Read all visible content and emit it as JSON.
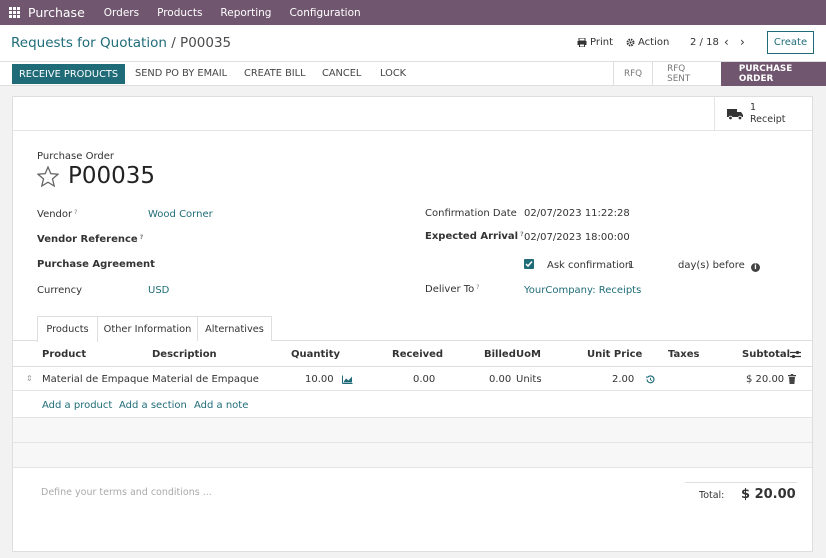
{
  "topbar": {
    "brand": "Purchase",
    "menus": [
      "Orders",
      "Products",
      "Reporting",
      "Configuration"
    ]
  },
  "control_panel": {
    "breadcrumb_parent": "Requests for Quotation",
    "breadcrumb_sep": "/",
    "breadcrumb_current": "P00035",
    "print_label": "Print",
    "action_label": "Action",
    "pager": "2 / 18",
    "create_label": "Create"
  },
  "statusbar": {
    "buttons": [
      "RECEIVE PRODUCTS",
      "SEND PO BY EMAIL",
      "CREATE BILL",
      "CANCEL",
      "LOCK"
    ],
    "stages": [
      "RFQ",
      "RFQ SENT",
      "PURCHASE ORDER"
    ],
    "active_stage": "PURCHASE ORDER"
  },
  "smart_button": {
    "count": "1",
    "label": "Receipt"
  },
  "form": {
    "doc_label": "Purchase Order",
    "doc_name": "P00035",
    "vendor_label": "Vendor",
    "vendor_value": "Wood Corner",
    "vendor_ref_label": "Vendor Reference",
    "agreement_label": "Purchase Agreement",
    "currency_label": "Currency",
    "currency_value": "USD",
    "confirmation_label": "Confirmation Date",
    "confirmation_value": "02/07/2023 11:22:28",
    "expected_label": "Expected Arrival",
    "expected_value": "02/07/2023 18:00:00",
    "ask_confirmation_label": "Ask confirmation",
    "ask_confirmation_days": "1",
    "days_before_label": "day(s) before",
    "deliver_label": "Deliver To",
    "deliver_value": "YourCompany: Receipts",
    "help_mark": "?"
  },
  "tabs": [
    "Products",
    "Other Information",
    "Alternatives"
  ],
  "table": {
    "headers": [
      "Product",
      "Description",
      "Quantity",
      "Received",
      "Billed",
      "UoM",
      "Unit Price",
      "Taxes",
      "Subtotal"
    ],
    "rows": [
      {
        "product": "Material de Empaque",
        "description": "Material de Empaque",
        "quantity": "10.00",
        "received": "0.00",
        "billed": "0.00",
        "uom": "Units",
        "unit_price": "2.00",
        "taxes": "",
        "subtotal": "$ 20.00"
      }
    ],
    "add_links": [
      "Add a product",
      "Add a section",
      "Add a note"
    ]
  },
  "footer": {
    "terms_placeholder": "Define your terms and conditions ...",
    "total_label": "Total:",
    "total_value": "$ 20.00"
  },
  "colors": {
    "brand": "#70566e",
    "accent": "#1f6c78"
  }
}
